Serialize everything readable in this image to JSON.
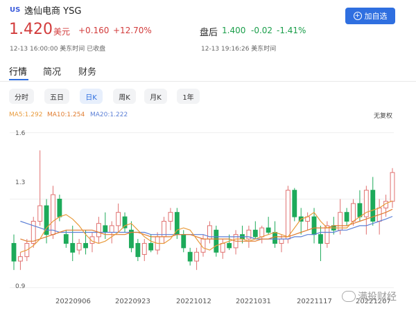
{
  "header": {
    "market": "US",
    "name": "逸仙电商 YSG",
    "add_label": "加自选",
    "price": "1.420",
    "unit": "美元",
    "change": "+0.160",
    "change_pct": "+12.70%",
    "time": "12-13 16:00:00 美东时间 已收盘",
    "after_hours_label": "盘后",
    "after_hours_price": "1.400",
    "after_hours_change": "-0.02",
    "after_hours_change_pct": "-1.41%",
    "after_hours_time": "12-13 19:16:26 美东时间"
  },
  "tabs": [
    "行情",
    "简况",
    "财务"
  ],
  "periods": [
    "分时",
    "五日",
    "日K",
    "周K",
    "月K",
    "1年"
  ],
  "active_period": "日K",
  "indicators": {
    "ma5": "MA5:1.292",
    "ma10": "MA10:1.254",
    "ma20": "MA20:1.222",
    "adjust": "无复权"
  },
  "colors": {
    "up": "#e0706f",
    "down": "#1daa5a",
    "ma5": "#e89b3c",
    "ma10": "#e07b2e",
    "ma20": "#5b7fd6",
    "accent": "#2f6fe0"
  },
  "watermark": "满投财经",
  "chart_data": {
    "type": "candlestick",
    "y_ticks": [
      "1.6",
      "1.3",
      "0.9"
    ],
    "ylim": [
      0.9,
      1.6
    ],
    "x_ticks": [
      "20220906",
      "20220923",
      "20221012",
      "20221031",
      "20221117",
      "20221207"
    ],
    "candles": [
      {
        "o": 1.1,
        "h": 1.14,
        "l": 0.98,
        "c": 1.02
      },
      {
        "o": 1.02,
        "h": 1.06,
        "l": 0.98,
        "c": 1.04
      },
      {
        "o": 1.04,
        "h": 1.12,
        "l": 1.02,
        "c": 1.1
      },
      {
        "o": 1.1,
        "h": 1.22,
        "l": 1.08,
        "c": 1.2
      },
      {
        "o": 1.2,
        "h": 1.52,
        "l": 1.18,
        "c": 1.27
      },
      {
        "o": 1.27,
        "h": 1.3,
        "l": 1.1,
        "c": 1.14
      },
      {
        "o": 1.14,
        "h": 1.36,
        "l": 1.12,
        "c": 1.32
      },
      {
        "o": 1.3,
        "h": 1.32,
        "l": 1.2,
        "c": 1.22
      },
      {
        "o": 1.14,
        "h": 1.16,
        "l": 1.08,
        "c": 1.1
      },
      {
        "o": 1.1,
        "h": 1.18,
        "l": 1.02,
        "c": 1.06
      },
      {
        "o": 1.07,
        "h": 1.12,
        "l": 1.05,
        "c": 1.1
      },
      {
        "o": 1.1,
        "h": 1.16,
        "l": 1.05,
        "c": 1.08
      },
      {
        "o": 1.1,
        "h": 1.15,
        "l": 1.06,
        "c": 1.13
      },
      {
        "o": 1.13,
        "h": 1.22,
        "l": 1.1,
        "c": 1.19
      },
      {
        "o": 1.18,
        "h": 1.24,
        "l": 1.12,
        "c": 1.15
      },
      {
        "o": 1.15,
        "h": 1.2,
        "l": 1.1,
        "c": 1.18
      },
      {
        "o": 1.18,
        "h": 1.28,
        "l": 1.15,
        "c": 1.24
      },
      {
        "o": 1.22,
        "h": 1.24,
        "l": 1.15,
        "c": 1.17
      },
      {
        "o": 1.16,
        "h": 1.2,
        "l": 1.06,
        "c": 1.08
      },
      {
        "o": 1.1,
        "h": 1.12,
        "l": 1.02,
        "c": 1.04
      },
      {
        "o": 1.05,
        "h": 1.12,
        "l": 1.02,
        "c": 1.1
      },
      {
        "o": 1.1,
        "h": 1.14,
        "l": 1.06,
        "c": 1.07
      },
      {
        "o": 1.07,
        "h": 1.15,
        "l": 1.05,
        "c": 1.13
      },
      {
        "o": 1.13,
        "h": 1.22,
        "l": 1.1,
        "c": 1.2
      },
      {
        "o": 1.2,
        "h": 1.26,
        "l": 1.16,
        "c": 1.24
      },
      {
        "o": 1.24,
        "h": 1.26,
        "l": 1.12,
        "c": 1.14
      },
      {
        "o": 1.14,
        "h": 1.16,
        "l": 1.06,
        "c": 1.08
      },
      {
        "o": 1.06,
        "h": 1.08,
        "l": 1.0,
        "c": 1.02
      },
      {
        "o": 1.02,
        "h": 1.08,
        "l": 0.98,
        "c": 1.06
      },
      {
        "o": 1.06,
        "h": 1.14,
        "l": 1.04,
        "c": 1.12
      },
      {
        "o": 1.12,
        "h": 1.2,
        "l": 1.1,
        "c": 1.18
      },
      {
        "o": 1.16,
        "h": 1.18,
        "l": 1.04,
        "c": 1.06
      },
      {
        "o": 1.06,
        "h": 1.12,
        "l": 1.03,
        "c": 1.1
      },
      {
        "o": 1.1,
        "h": 1.14,
        "l": 1.07,
        "c": 1.08
      },
      {
        "o": 1.08,
        "h": 1.16,
        "l": 1.05,
        "c": 1.14
      },
      {
        "o": 1.14,
        "h": 1.18,
        "l": 1.1,
        "c": 1.12
      },
      {
        "o": 1.12,
        "h": 1.18,
        "l": 1.08,
        "c": 1.16
      },
      {
        "o": 1.16,
        "h": 1.2,
        "l": 1.12,
        "c": 1.13
      },
      {
        "o": 1.13,
        "h": 1.18,
        "l": 1.1,
        "c": 1.17
      },
      {
        "o": 1.17,
        "h": 1.22,
        "l": 1.14,
        "c": 1.15
      },
      {
        "o": 1.15,
        "h": 1.2,
        "l": 1.08,
        "c": 1.1
      },
      {
        "o": 1.1,
        "h": 1.14,
        "l": 1.06,
        "c": 1.12
      },
      {
        "o": 1.12,
        "h": 1.36,
        "l": 1.1,
        "c": 1.34
      },
      {
        "o": 1.34,
        "h": 1.35,
        "l": 1.2,
        "c": 1.22
      },
      {
        "o": 1.22,
        "h": 1.26,
        "l": 1.14,
        "c": 1.2
      },
      {
        "o": 1.2,
        "h": 1.24,
        "l": 1.16,
        "c": 1.22
      },
      {
        "o": 1.22,
        "h": 1.26,
        "l": 1.1,
        "c": 1.14
      },
      {
        "o": 1.14,
        "h": 1.18,
        "l": 1.02,
        "c": 1.1
      },
      {
        "o": 1.1,
        "h": 1.2,
        "l": 1.08,
        "c": 1.18
      },
      {
        "o": 1.18,
        "h": 1.22,
        "l": 1.14,
        "c": 1.16
      },
      {
        "o": 1.16,
        "h": 1.3,
        "l": 1.14,
        "c": 1.24
      },
      {
        "o": 1.24,
        "h": 1.26,
        "l": 1.18,
        "c": 1.2
      },
      {
        "o": 1.2,
        "h": 1.3,
        "l": 1.18,
        "c": 1.28
      },
      {
        "o": 1.28,
        "h": 1.34,
        "l": 1.2,
        "c": 1.22
      },
      {
        "o": 1.22,
        "h": 1.36,
        "l": 1.14,
        "c": 1.34
      },
      {
        "o": 1.34,
        "h": 1.4,
        "l": 1.18,
        "c": 1.2
      },
      {
        "o": 1.2,
        "h": 1.3,
        "l": 1.14,
        "c": 1.26
      },
      {
        "o": 1.26,
        "h": 1.32,
        "l": 1.22,
        "c": 1.29
      },
      {
        "o": 1.29,
        "h": 1.44,
        "l": 1.26,
        "c": 1.42
      }
    ],
    "ma5": [
      1.06,
      1.07,
      1.09,
      1.12,
      1.17,
      1.2,
      1.22,
      1.23,
      1.21,
      1.18,
      1.14,
      1.11,
      1.1,
      1.11,
      1.13,
      1.15,
      1.18,
      1.19,
      1.16,
      1.13,
      1.11,
      1.1,
      1.1,
      1.12,
      1.16,
      1.17,
      1.16,
      1.12,
      1.08,
      1.07,
      1.09,
      1.1,
      1.11,
      1.12,
      1.12,
      1.11,
      1.12,
      1.13,
      1.14,
      1.15,
      1.14,
      1.13,
      1.17,
      1.21,
      1.22,
      1.24,
      1.2,
      1.17,
      1.17,
      1.17,
      1.17,
      1.2,
      1.22,
      1.24,
      1.25,
      1.26,
      1.28,
      1.292
    ],
    "ma10": [
      1.12,
      1.11,
      1.11,
      1.12,
      1.13,
      1.14,
      1.15,
      1.16,
      1.16,
      1.16,
      1.16,
      1.16,
      1.15,
      1.14,
      1.14,
      1.14,
      1.14,
      1.15,
      1.15,
      1.14,
      1.13,
      1.13,
      1.13,
      1.13,
      1.14,
      1.14,
      1.14,
      1.13,
      1.12,
      1.12,
      1.12,
      1.12,
      1.12,
      1.11,
      1.11,
      1.11,
      1.11,
      1.12,
      1.12,
      1.13,
      1.13,
      1.13,
      1.14,
      1.15,
      1.16,
      1.17,
      1.17,
      1.17,
      1.18,
      1.18,
      1.18,
      1.19,
      1.2,
      1.21,
      1.22,
      1.23,
      1.24,
      1.254
    ],
    "ma20": [
      1.2,
      1.19,
      1.18,
      1.17,
      1.16,
      1.16,
      1.15,
      1.15,
      1.15,
      1.15,
      1.15,
      1.15,
      1.15,
      1.15,
      1.15,
      1.15,
      1.15,
      1.15,
      1.15,
      1.15,
      1.14,
      1.14,
      1.14,
      1.14,
      1.14,
      1.14,
      1.14,
      1.14,
      1.14,
      1.13,
      1.13,
      1.13,
      1.13,
      1.13,
      1.13,
      1.13,
      1.12,
      1.12,
      1.12,
      1.12,
      1.12,
      1.12,
      1.13,
      1.13,
      1.14,
      1.14,
      1.15,
      1.15,
      1.15,
      1.16,
      1.16,
      1.17,
      1.18,
      1.18,
      1.19,
      1.2,
      1.21,
      1.222
    ]
  }
}
